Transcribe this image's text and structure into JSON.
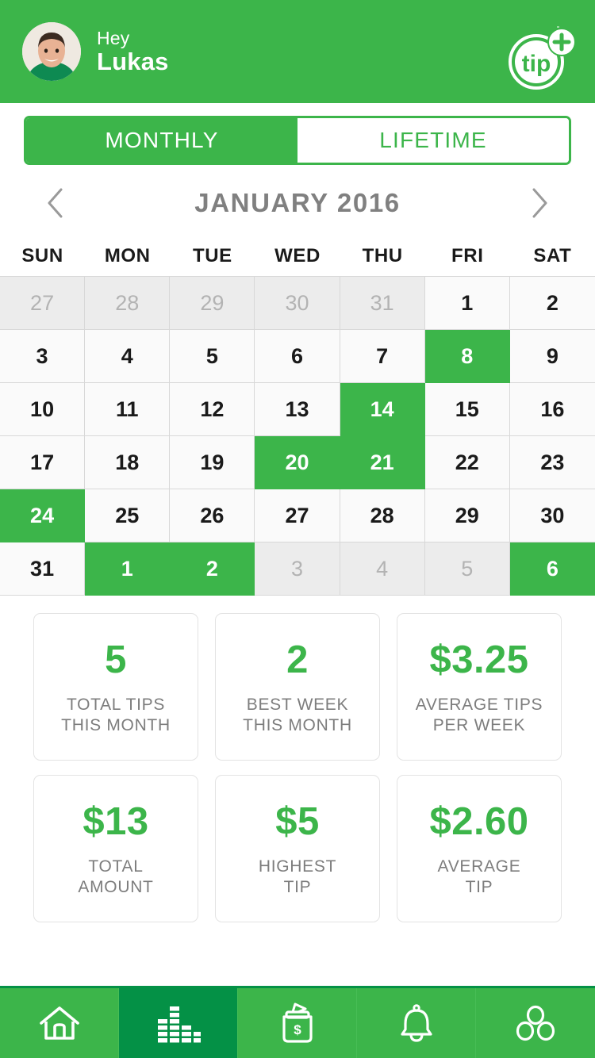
{
  "header": {
    "greeting": "Hey",
    "user_name": "Lukas",
    "avatar_icon": "user-avatar-photo",
    "logo_text": "tip",
    "logo_badge": "+",
    "background_color": "#3CB54A"
  },
  "tabs": {
    "items": [
      {
        "label": "MONTHLY",
        "active": true
      },
      {
        "label": "LIFETIME",
        "active": false
      }
    ]
  },
  "month_nav": {
    "prev_icon": "chevron-left-icon",
    "next_icon": "chevron-right-icon",
    "label": "JANUARY 2016"
  },
  "calendar": {
    "weekday_headers": [
      "SUN",
      "MON",
      "TUE",
      "WED",
      "THU",
      "FRI",
      "SAT"
    ],
    "cells": [
      {
        "day": "27",
        "state": "other"
      },
      {
        "day": "28",
        "state": "other"
      },
      {
        "day": "29",
        "state": "other"
      },
      {
        "day": "30",
        "state": "other"
      },
      {
        "day": "31",
        "state": "other"
      },
      {
        "day": "1",
        "state": "normal"
      },
      {
        "day": "2",
        "state": "normal"
      },
      {
        "day": "3",
        "state": "normal"
      },
      {
        "day": "4",
        "state": "normal"
      },
      {
        "day": "5",
        "state": "normal"
      },
      {
        "day": "6",
        "state": "normal"
      },
      {
        "day": "7",
        "state": "normal"
      },
      {
        "day": "8",
        "state": "marked"
      },
      {
        "day": "9",
        "state": "normal"
      },
      {
        "day": "10",
        "state": "normal"
      },
      {
        "day": "11",
        "state": "normal"
      },
      {
        "day": "12",
        "state": "normal"
      },
      {
        "day": "13",
        "state": "normal"
      },
      {
        "day": "14",
        "state": "marked"
      },
      {
        "day": "15",
        "state": "normal"
      },
      {
        "day": "16",
        "state": "normal"
      },
      {
        "day": "17",
        "state": "normal"
      },
      {
        "day": "18",
        "state": "normal"
      },
      {
        "day": "19",
        "state": "normal"
      },
      {
        "day": "20",
        "state": "marked"
      },
      {
        "day": "21",
        "state": "marked"
      },
      {
        "day": "22",
        "state": "normal"
      },
      {
        "day": "23",
        "state": "normal"
      },
      {
        "day": "24",
        "state": "marked"
      },
      {
        "day": "25",
        "state": "normal"
      },
      {
        "day": "26",
        "state": "normal"
      },
      {
        "day": "27",
        "state": "normal"
      },
      {
        "day": "28",
        "state": "normal"
      },
      {
        "day": "29",
        "state": "normal"
      },
      {
        "day": "30",
        "state": "normal"
      },
      {
        "day": "31",
        "state": "normal"
      },
      {
        "day": "1",
        "state": "marked"
      },
      {
        "day": "2",
        "state": "marked"
      },
      {
        "day": "3",
        "state": "other"
      },
      {
        "day": "4",
        "state": "other"
      },
      {
        "day": "5",
        "state": "other"
      },
      {
        "day": "6",
        "state": "marked"
      }
    ],
    "marked_color": "#3CB54A"
  },
  "stats": {
    "cards": [
      {
        "value": "5",
        "label_line1": "TOTAL TIPS",
        "label_line2": "THIS MONTH"
      },
      {
        "value": "2",
        "label_line1": "BEST WEEK",
        "label_line2": "THIS MONTH"
      },
      {
        "value": "$3.25",
        "label_line1": "AVERAGE TIPS",
        "label_line2": "PER WEEK"
      },
      {
        "value": "$13",
        "label_line1": "TOTAL",
        "label_line2": "AMOUNT"
      },
      {
        "value": "$5",
        "label_line1": "HIGHEST",
        "label_line2": "TIP"
      },
      {
        "value": "$2.60",
        "label_line1": "AVERAGE",
        "label_line2": "TIP"
      }
    ],
    "value_color": "#3CB54A"
  },
  "bottom_nav": {
    "items": [
      {
        "icon": "home-icon",
        "active": false
      },
      {
        "icon": "bar-chart-icon",
        "active": true
      },
      {
        "icon": "tip-jar-icon",
        "active": false
      },
      {
        "icon": "bell-icon",
        "active": false
      },
      {
        "icon": "more-circles-icon",
        "active": false
      }
    ],
    "active_color": "#049146",
    "background_color": "#3CB54A"
  }
}
